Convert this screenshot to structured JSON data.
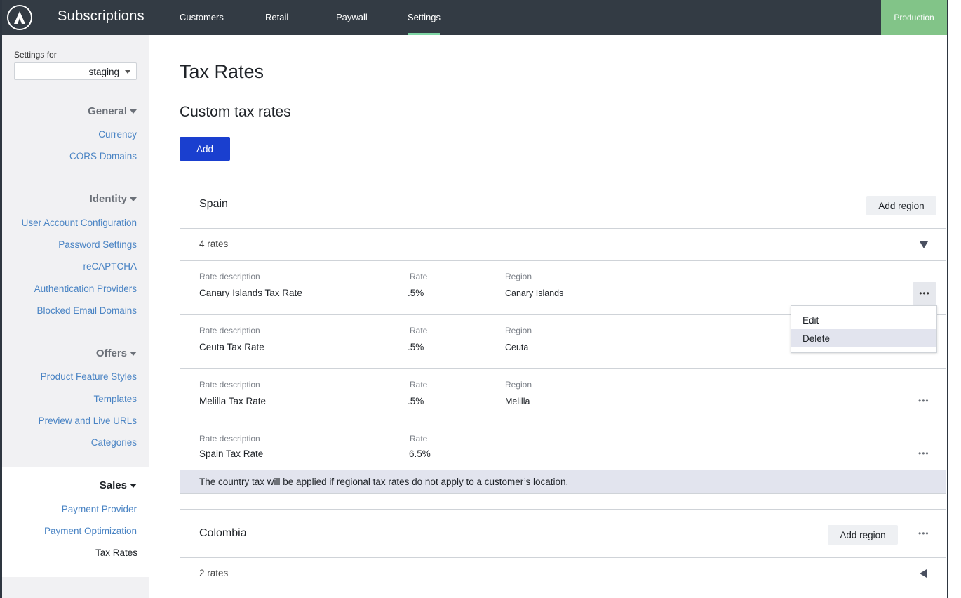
{
  "app": {
    "title": "Subscriptions"
  },
  "nav": {
    "items": [
      "Customers",
      "Retail",
      "Paywall",
      "Settings"
    ],
    "active": "Settings",
    "environment": "Production"
  },
  "sidebar": {
    "settings_for_label": "Settings for",
    "environment_value": "staging",
    "sections": [
      {
        "title": "General",
        "links": [
          "Currency",
          "CORS Domains"
        ]
      },
      {
        "title": "Identity",
        "links": [
          "User Account Configuration",
          "Password Settings",
          "reCAPTCHA",
          "Authentication Providers",
          "Blocked Email Domains"
        ]
      },
      {
        "title": "Offers",
        "links": [
          "Product Feature Styles",
          "Templates",
          "Preview and Live URLs",
          "Categories"
        ]
      },
      {
        "title": "Sales",
        "links": [
          "Payment Provider",
          "Payment Optimization",
          "Tax Rates"
        ]
      }
    ],
    "current_link": "Tax Rates"
  },
  "main": {
    "page_title": "Tax Rates",
    "section_title": "Custom tax rates",
    "add_label": "Add",
    "column_labels": {
      "description": "Rate description",
      "rate": "Rate",
      "region": "Region"
    },
    "countries": [
      {
        "name": "Spain",
        "add_region_label": "Add region",
        "rates_count": "4 rates",
        "expanded": true,
        "rates": [
          {
            "description": "Canary Islands Tax Rate",
            "rate": ".5%",
            "region": "Canary Islands"
          },
          {
            "description": "Ceuta Tax Rate",
            "rate": ".5%",
            "region": "Ceuta"
          },
          {
            "description": "Melilla Tax Rate",
            "rate": ".5%",
            "region": "Melilla"
          },
          {
            "description": "Spain Tax Rate",
            "rate": "6.5%",
            "region": ""
          }
        ],
        "note": "The country tax will be applied if regional tax rates do not apply to a customer’s location."
      },
      {
        "name": "Colombia",
        "add_region_label": "Add region",
        "rates_count": "2 rates",
        "expanded": false
      }
    ],
    "more_glyph": "•••",
    "context_menu": {
      "items": [
        "Edit",
        "Delete"
      ],
      "highlighted": "Delete"
    }
  }
}
